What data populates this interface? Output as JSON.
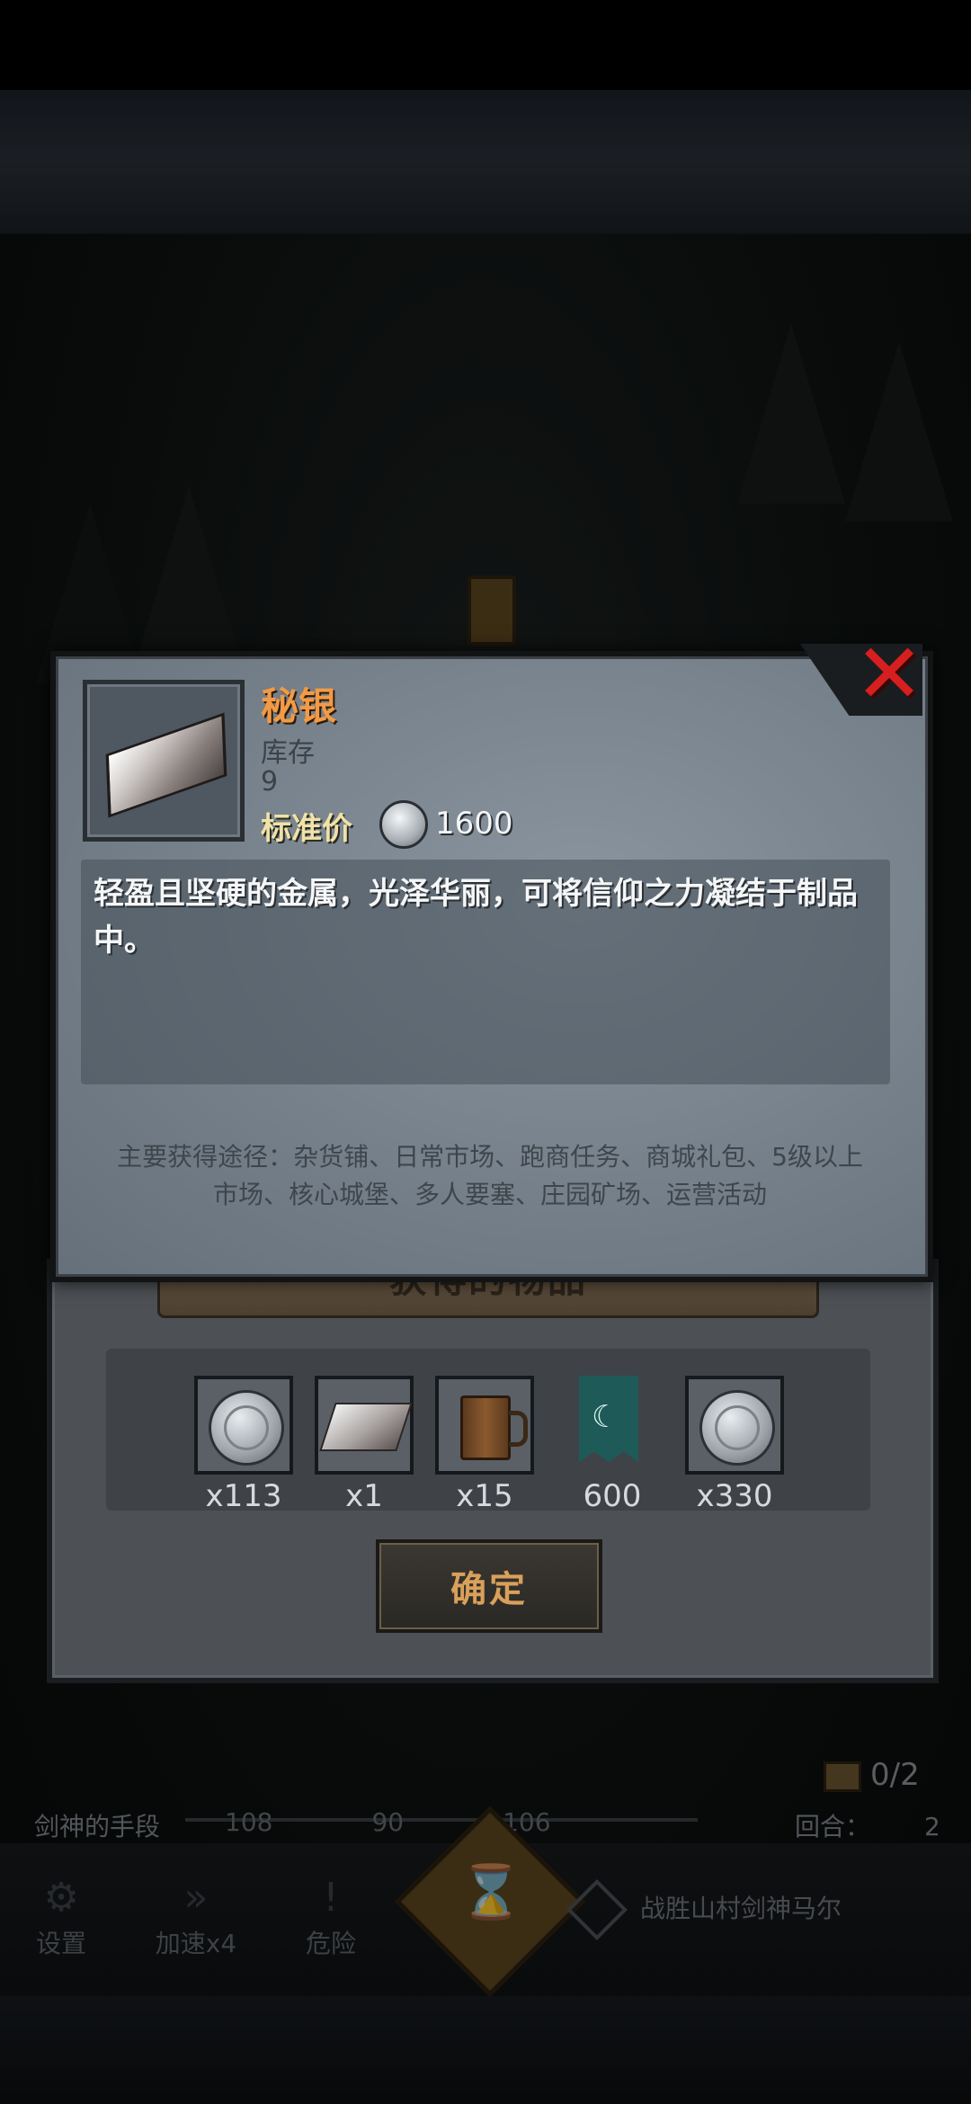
{
  "item": {
    "name": "秘银",
    "stock_label": "库存",
    "stock_value": "9",
    "price_label": "标准价",
    "price_value": "1600",
    "description": "轻盈且坚硬的金属，光泽华丽，可将信仰之力凝结于制品中。",
    "sources": "主要获得途径：杂货铺、日常市场、跑商任务、商城礼包、5级以上市场、核心城堡、多人要塞、庄园矿场、运营活动"
  },
  "rewards_dialog": {
    "title": "获得的物品",
    "items": [
      {
        "icon": "silver-coin-icon",
        "qty": "x113"
      },
      {
        "icon": "mithril-ingot-icon",
        "qty": "x1"
      },
      {
        "icon": "wooden-mug-icon",
        "qty": "x15"
      },
      {
        "icon": "faith-banner-icon",
        "qty": "600"
      },
      {
        "icon": "silver-coin-icon",
        "qty": "x330"
      }
    ],
    "confirm_label": "确定"
  },
  "hud": {
    "chest_counter": "0/2",
    "skill_label": "剑神的手段",
    "track_values": [
      "108",
      "90",
      "106"
    ],
    "round_label": "回合：",
    "round_value": "2",
    "buttons": [
      {
        "label": "设置",
        "icon": "gear-icon"
      },
      {
        "label": "加速x4",
        "icon": "fast-forward-icon"
      },
      {
        "label": "危险",
        "icon": "exclamation-icon"
      }
    ],
    "quest_text": "战胜山村剑神马尔"
  },
  "colors": {
    "item_name": "#f29a45",
    "close_x": "#d71f1f",
    "confirm_text": "#d9a05a",
    "panel": "#7a858f"
  }
}
